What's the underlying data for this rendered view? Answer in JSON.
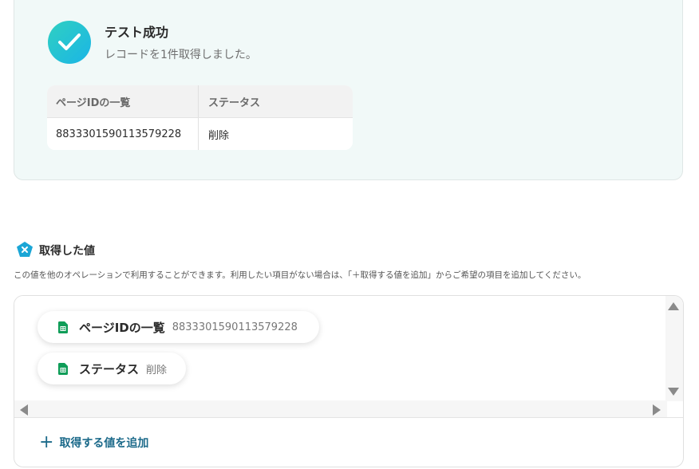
{
  "success": {
    "title": "テスト成功",
    "subtitle": "レコードを1件取得しました。",
    "table": {
      "headers": [
        "ページIDの一覧",
        "ステータス"
      ],
      "rows": [
        [
          "8833301590113579228",
          "削除"
        ]
      ]
    }
  },
  "acquired": {
    "title": "取得した値",
    "description": "この値を他のオペレーションで利用することができます。利用したい項目がない場合は、「＋取得する値を追加」からご希望の項目を追加してください。",
    "items": [
      {
        "label": "ページIDの一覧",
        "value": "8833301590113579228",
        "icon": "sheets-icon"
      },
      {
        "label": "ステータス",
        "value": "削除",
        "icon": "sheets-icon"
      }
    ],
    "add_button": "取得する値を追加"
  },
  "colors": {
    "accent": "#1c6a8a",
    "success_gradient_start": "#2fd0c1",
    "success_gradient_end": "#1bb5e6",
    "sheets_green": "#0f9d58"
  }
}
